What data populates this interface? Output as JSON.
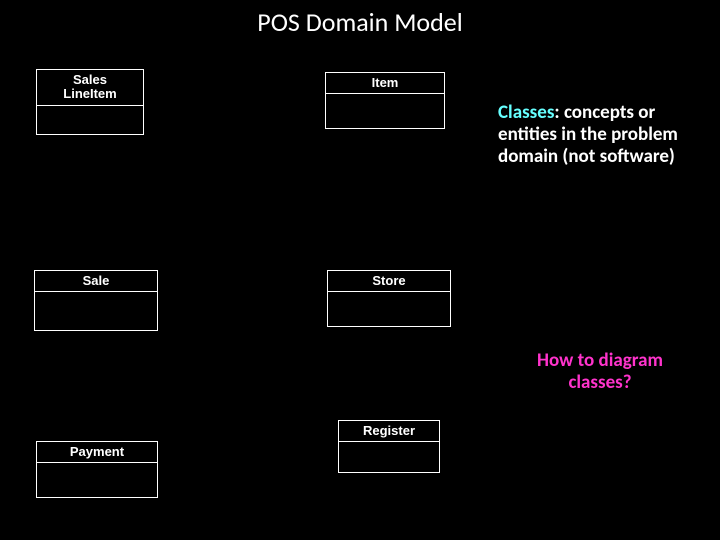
{
  "title": "POS Domain Model",
  "classes": {
    "salesLineItem": "Sales\nLineItem",
    "item": "Item",
    "sale": "Sale",
    "store": "Store",
    "payment": "Payment",
    "register": "Register"
  },
  "note1": {
    "keyword": "Classes",
    "rest": ": concepts or entities in the problem domain (not software)"
  },
  "note2": "How to diagram classes?"
}
